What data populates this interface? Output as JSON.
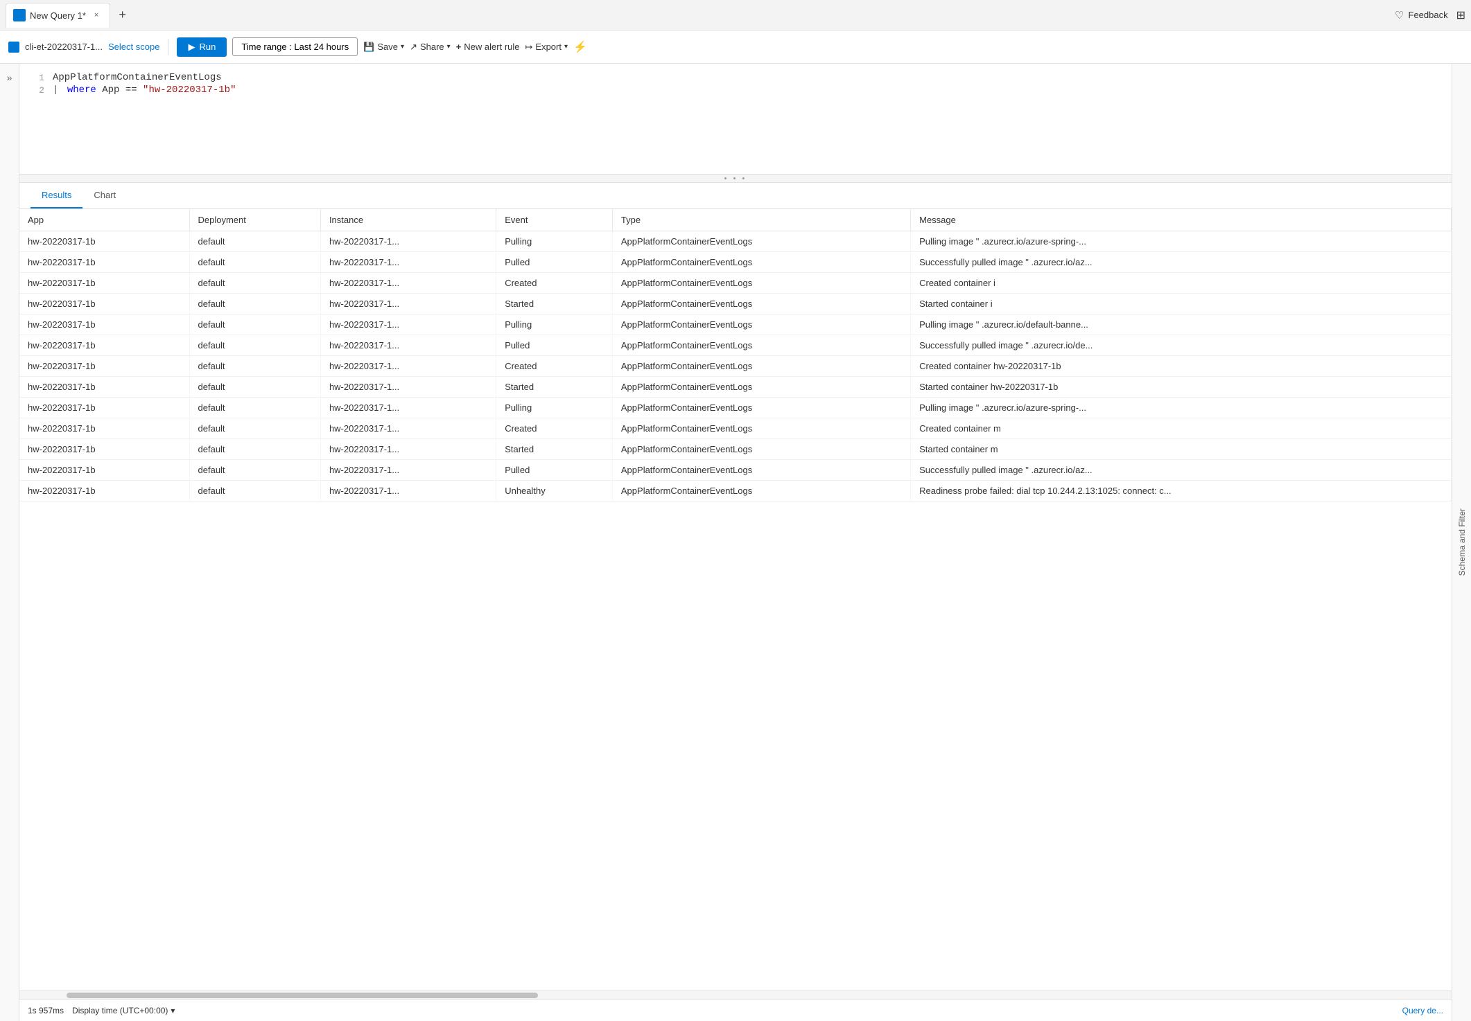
{
  "tab": {
    "title": "New Query 1*",
    "close_label": "×",
    "add_label": "+"
  },
  "feedback": {
    "label": "Feedback"
  },
  "toolbar": {
    "scope_icon": "azure",
    "scope_name": "cli-et-20220317-1...",
    "select_scope_label": "Select scope",
    "run_label": "Run",
    "time_range_label": "Time range : Last 24 hours",
    "save_label": "Save",
    "share_label": "Share",
    "new_alert_label": "New alert rule",
    "export_label": "Export"
  },
  "editor": {
    "lines": [
      {
        "num": "1",
        "content": "AppPlatformContainerEventLogs"
      },
      {
        "num": "2",
        "content": "| where App == \"hw-20220317-1b\""
      }
    ]
  },
  "results": {
    "tabs": [
      {
        "label": "Results",
        "active": true
      },
      {
        "label": "Chart",
        "active": false
      }
    ],
    "columns": [
      "App",
      "Deployment",
      "Instance",
      "Event",
      "Type",
      "Message"
    ],
    "rows": [
      {
        "app": "hw-20220317-1b",
        "deployment": "default",
        "instance": "hw-20220317-1...",
        "event": "Pulling",
        "type": "AppPlatformContainerEventLogs",
        "message": "Pulling image \"",
        "message_suffix": ".azurecr.io/azure-spring-..."
      },
      {
        "app": "hw-20220317-1b",
        "deployment": "default",
        "instance": "hw-20220317-1...",
        "event": "Pulled",
        "type": "AppPlatformContainerEventLogs",
        "message": "Successfully pulled image \"",
        "message_suffix": ".azurecr.io/az..."
      },
      {
        "app": "hw-20220317-1b",
        "deployment": "default",
        "instance": "hw-20220317-1...",
        "event": "Created",
        "type": "AppPlatformContainerEventLogs",
        "message": "Created container i",
        "message_suffix": ""
      },
      {
        "app": "hw-20220317-1b",
        "deployment": "default",
        "instance": "hw-20220317-1...",
        "event": "Started",
        "type": "AppPlatformContainerEventLogs",
        "message": "Started container i",
        "message_suffix": ""
      },
      {
        "app": "hw-20220317-1b",
        "deployment": "default",
        "instance": "hw-20220317-1...",
        "event": "Pulling",
        "type": "AppPlatformContainerEventLogs",
        "message": "Pulling image \"",
        "message_suffix": ".azurecr.io/default-banne..."
      },
      {
        "app": "hw-20220317-1b",
        "deployment": "default",
        "instance": "hw-20220317-1...",
        "event": "Pulled",
        "type": "AppPlatformContainerEventLogs",
        "message": "Successfully pulled image \"",
        "message_suffix": ".azurecr.io/de..."
      },
      {
        "app": "hw-20220317-1b",
        "deployment": "default",
        "instance": "hw-20220317-1...",
        "event": "Created",
        "type": "AppPlatformContainerEventLogs",
        "message": "Created container hw-20220317-1b",
        "message_suffix": ""
      },
      {
        "app": "hw-20220317-1b",
        "deployment": "default",
        "instance": "hw-20220317-1...",
        "event": "Started",
        "type": "AppPlatformContainerEventLogs",
        "message": "Started container hw-20220317-1b",
        "message_suffix": ""
      },
      {
        "app": "hw-20220317-1b",
        "deployment": "default",
        "instance": "hw-20220317-1...",
        "event": "Pulling",
        "type": "AppPlatformContainerEventLogs",
        "message": "Pulling image \"",
        "message_suffix": ".azurecr.io/azure-spring-..."
      },
      {
        "app": "hw-20220317-1b",
        "deployment": "default",
        "instance": "hw-20220317-1...",
        "event": "Created",
        "type": "AppPlatformContainerEventLogs",
        "message": "Created container m",
        "message_suffix": ""
      },
      {
        "app": "hw-20220317-1b",
        "deployment": "default",
        "instance": "hw-20220317-1...",
        "event": "Started",
        "type": "AppPlatformContainerEventLogs",
        "message": "Started container m",
        "message_suffix": ""
      },
      {
        "app": "hw-20220317-1b",
        "deployment": "default",
        "instance": "hw-20220317-1...",
        "event": "Pulled",
        "type": "AppPlatformContainerEventLogs",
        "message": "Successfully pulled image \"",
        "message_suffix": ".azurecr.io/az..."
      },
      {
        "app": "hw-20220317-1b",
        "deployment": "default",
        "instance": "hw-20220317-1...",
        "event": "Unhealthy",
        "type": "AppPlatformContainerEventLogs",
        "message": "Readiness probe failed: dial tcp 10.244.2.13:1025: connect: c...",
        "message_suffix": ""
      }
    ]
  },
  "status": {
    "time": "1s 957ms",
    "display_time_label": "Display time (UTC+00:00)",
    "query_details_label": "Query de..."
  },
  "right_sidebar": {
    "label": "Schema and Filter"
  }
}
